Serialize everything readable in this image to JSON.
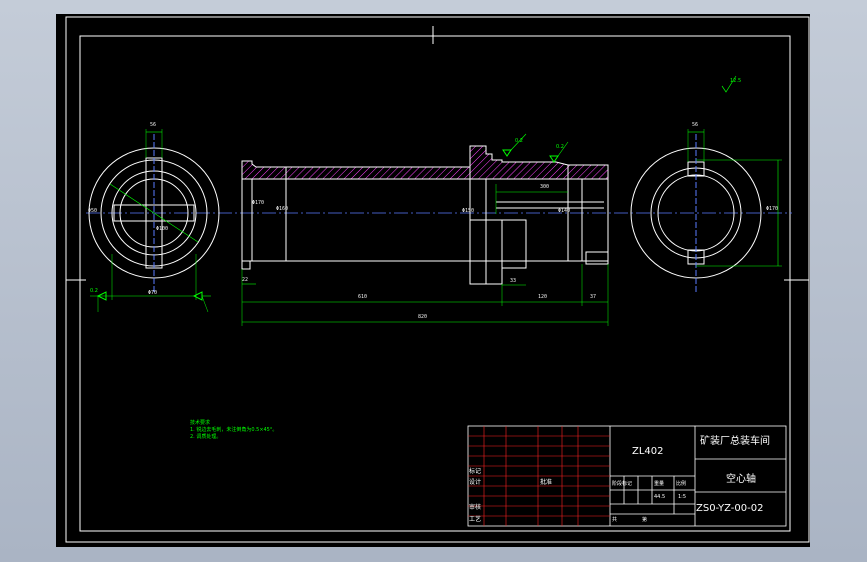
{
  "colors": {
    "background": "#000000",
    "border": "#ffffff",
    "dimension": "#00ff00",
    "hatch": "#ff44ff",
    "centerline": "#5a7cff",
    "table_red": "#ff2020"
  },
  "title_block": {
    "model": "ZL402",
    "company": "矿装厂总装车间",
    "part_name": "空心轴",
    "drawing_no": "ZS0-YZ-00-02",
    "row_labels": {
      "mark": "标记",
      "design": "设计",
      "review": "审核",
      "craft": "工艺"
    },
    "small_labels": {
      "approve": "批准",
      "stage": "阶段标记",
      "weight": "重量",
      "scale": "比例",
      "sheet": "共",
      "of": "第",
      "one": "1"
    },
    "weight": "44.5",
    "scale": "1:5"
  },
  "notes": {
    "title": "技术要求",
    "lines": [
      "1. 锐边去毛刺，未注倒角为0.5×45°。",
      "2. 调质处理。"
    ]
  },
  "dims": {
    "left_top": "56",
    "left_side": "Φ50",
    "left_bore": "Φ100",
    "left_bottom": "Φ70",
    "left_tol": "0.2",
    "main_top": "300",
    "main_dia1": "Φ170",
    "main_dia2": "Φ160",
    "main_dia3": "Φ150",
    "main_dia4": "Φ140",
    "main_len1": "610",
    "main_len2": "120",
    "main_len3": "33",
    "main_len4": "37",
    "main_len5": "22",
    "main_total": "820",
    "right_top": "56",
    "right_side": "Φ170",
    "tol1": "0.2",
    "tol2": "0.2",
    "roughness": "12.5"
  }
}
